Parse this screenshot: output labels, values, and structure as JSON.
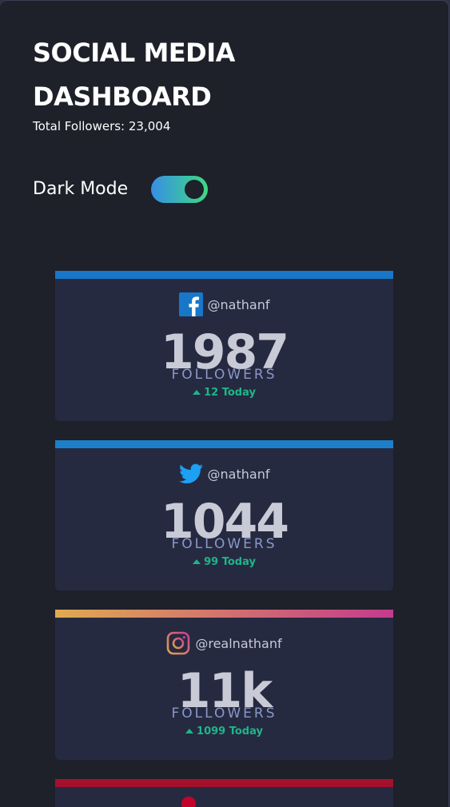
{
  "header": {
    "title": "SOCIAL MEDIA DASHBOARD",
    "total_label": "Total Followers: ",
    "total_value": "23,004"
  },
  "theme": {
    "toggle_label": "Dark Mode",
    "dark_mode_on": true
  },
  "cards": [
    {
      "platform": "facebook",
      "icon": "facebook-icon",
      "accent": "#1877c9",
      "handle": "@nathanf",
      "count": "1987",
      "unit": "FOLLOWERS",
      "today": "12 Today"
    },
    {
      "platform": "twitter",
      "icon": "twitter-icon",
      "accent": "#1b7fc9",
      "handle": "@nathanf",
      "count": "1044",
      "unit": "FOLLOWERS",
      "today": "99 Today"
    },
    {
      "platform": "instagram",
      "icon": "instagram-icon",
      "accent": "linear-gradient(90deg, #e0aa4f, #c33b8e)",
      "handle": "@realnathanf",
      "count": "11k",
      "unit": "FOLLOWERS",
      "today": "1099 Today"
    },
    {
      "platform": "youtube",
      "icon": "youtube-icon",
      "accent": "#a4112c"
    }
  ],
  "colors": {
    "background": "#1e202a",
    "card": "#252a41",
    "positive": "#1eb589",
    "toggle_start": "#378fe6",
    "toggle_end": "#3eda82"
  }
}
